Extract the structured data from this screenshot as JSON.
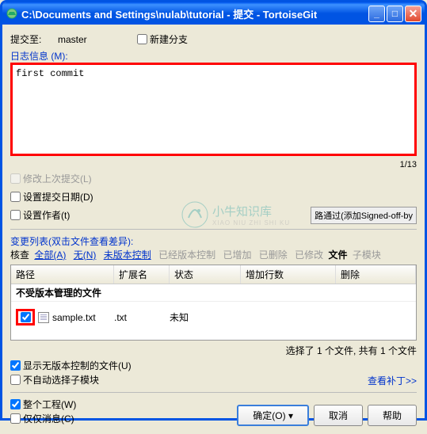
{
  "titlebar": {
    "title": "C:\\Documents and Settings\\nulab\\tutorial - 提交 - TortoiseGit"
  },
  "commit": {
    "to_label": "提交至:",
    "branch": "master",
    "new_branch": "新建分支"
  },
  "log": {
    "section_label": "日志信息 (M):",
    "message": "first commit",
    "counter": "1/13",
    "amend": "修改上次提交(L)",
    "set_date": "设置提交日期(D)",
    "set_author": "设置作者(t)",
    "signed_off": "路通过(添加Signed-off-by"
  },
  "changes": {
    "section_label": "变更列表(双击文件查看差异):",
    "check_label": "核查",
    "filter_all": "全部(A)",
    "filter_none": "无(N)",
    "filter_unversioned": "未版本控制",
    "filter_versioned": "已经版本控制",
    "filter_added": "已增加",
    "filter_deleted": "已删除",
    "filter_modified": "已修改",
    "filter_files": "文件",
    "filter_submod": "子模块",
    "col_path": "路径",
    "col_ext": "扩展名",
    "col_status": "状态",
    "col_add": "增加行数",
    "col_del": "删除",
    "group_unmanaged": "不受版本管理的文件",
    "file": {
      "name": "sample.txt",
      "ext": ".txt",
      "status": "未知"
    },
    "selection_status": "选择了 1 个文件, 共有 1 个文件",
    "show_unversioned": "显示无版本控制的文件(U)",
    "no_auto_submod": "不自动选择子模块",
    "view_patch": "查看补丁>>",
    "whole_project": "整个工程(W)",
    "msg_only": "仅仅消息(C)"
  },
  "buttons": {
    "ok": "确定(O)",
    "cancel": "取消",
    "help": "帮助"
  },
  "watermark": {
    "text": "小牛知识库",
    "sub": "XIAO NIU ZHI SHI KU"
  }
}
